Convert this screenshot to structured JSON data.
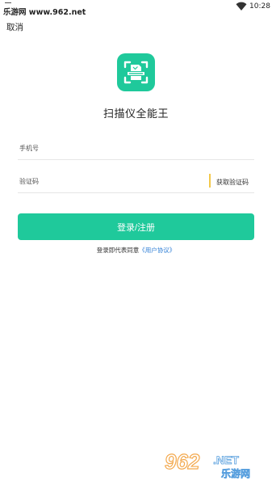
{
  "status_bar": {
    "watermark_text": "乐游网 www.962.net",
    "time": "10:28"
  },
  "header": {
    "cancel_label": "取消"
  },
  "app": {
    "title": "扫描仪全能王",
    "logo_icon": "scanner-document-icon",
    "brand_color": "#1fc99b"
  },
  "form": {
    "phone_placeholder": "手机号",
    "code_placeholder": "验证码",
    "get_code_label": "获取验证码",
    "submit_label": "登录/注册"
  },
  "agreement": {
    "prefix": "登录即代表同意",
    "link_text": "《用户协议》"
  },
  "watermark_logo": {
    "brand": "962",
    "suffix": ".NET",
    "subtitle": "乐游网"
  }
}
